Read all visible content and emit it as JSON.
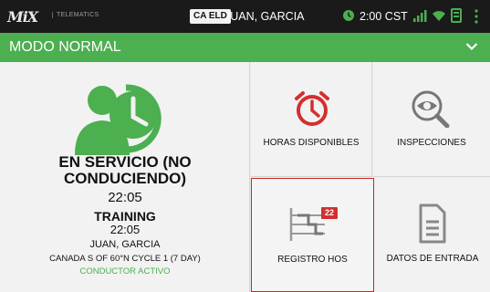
{
  "statusbar": {
    "brand": "MiX",
    "brand_sub": "TELEMATICS",
    "eld_badge": "CA ELD",
    "driver_name": "JUAN, GARCIA",
    "time": "2:00 CST",
    "icons": [
      "clock-icon",
      "signal-icon",
      "wifi-icon",
      "device-icon",
      "menu-icon"
    ]
  },
  "mode": {
    "label": "MODO NORMAL",
    "icon": "chevron-down-icon"
  },
  "status": {
    "title_line1": "EN SERVICIO (NO",
    "title_line2": "CONDUCIENDO)",
    "time": "22:05",
    "cycle_name": "TRAINING",
    "cycle_time": "22:05",
    "driver": "JUAN, GARCIA",
    "ruleset": "CANADA S OF 60°N CYCLE 1 (7 DAY)",
    "driver_status": "CONDUCTOR ACTIVO"
  },
  "tiles": [
    {
      "label": "HORAS DISPONIBLES",
      "icon": "alarm-clock-icon"
    },
    {
      "label": "INSPECCIONES",
      "icon": "magnifier-eye-icon"
    },
    {
      "label": "REGISTRO HOS",
      "icon": "log-chart-icon",
      "badge": "22"
    },
    {
      "label": "DATOS DE ENTRADA",
      "icon": "document-icon"
    }
  ],
  "colors": {
    "accent_green": "#4caf50",
    "alert_red": "#d32f2f",
    "dark_bar": "#1a1a1a",
    "panel_bg": "#f2f2f2"
  }
}
